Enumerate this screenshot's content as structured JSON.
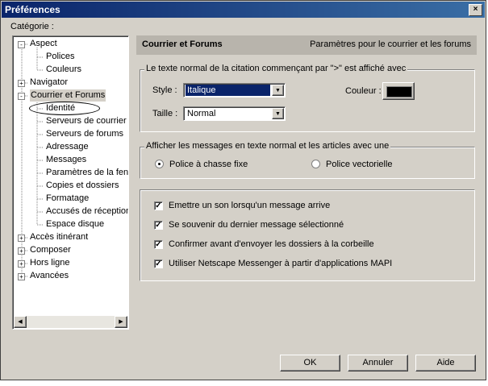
{
  "window": {
    "title": "Préférences",
    "close_glyph": "×"
  },
  "category_label": "Catégorie :",
  "tree": {
    "items": [
      {
        "label": "Aspect",
        "level": 0,
        "expander": "-"
      },
      {
        "label": "Polices",
        "level": 1
      },
      {
        "label": "Couleurs",
        "level": 1
      },
      {
        "label": "Navigator",
        "level": 0,
        "expander": "+"
      },
      {
        "label": "Courrier et Forums",
        "level": 0,
        "expander": "-",
        "selected": true
      },
      {
        "label": "Identité",
        "level": 1,
        "circled": true
      },
      {
        "label": "Serveurs de courrier",
        "level": 1
      },
      {
        "label": "Serveurs de forums",
        "level": 1
      },
      {
        "label": "Adressage",
        "level": 1
      },
      {
        "label": "Messages",
        "level": 1
      },
      {
        "label": "Paramètres de la fenê",
        "level": 1
      },
      {
        "label": "Copies et dossiers",
        "level": 1
      },
      {
        "label": "Formatage",
        "level": 1
      },
      {
        "label": "Accusés de réception",
        "level": 1
      },
      {
        "label": "Espace disque",
        "level": 1
      },
      {
        "label": "Accès itinérant",
        "level": 0,
        "expander": "+"
      },
      {
        "label": "Composer",
        "level": 0,
        "expander": "+"
      },
      {
        "label": "Hors ligne",
        "level": 0,
        "expander": "+"
      },
      {
        "label": "Avancées",
        "level": 0,
        "expander": "+"
      }
    ],
    "scroll_left_glyph": "◀",
    "scroll_right_glyph": "▶"
  },
  "panel": {
    "title": "Courrier et Forums",
    "subtitle": "Paramètres pour le courrier et les forums"
  },
  "quote_group": {
    "legend": "Le texte normal de la citation commençant par \">\" est affiché avec",
    "style_label": "Style :",
    "style_value": "Italique",
    "size_label": "Taille :",
    "size_value": "Normal",
    "color_label": "Couleur :",
    "color_value": "#000000",
    "arrow_glyph": "▼"
  },
  "font_group": {
    "legend": "Afficher les messages en texte normal et les articles avec une",
    "options": [
      {
        "label": "Police à chasse fixe",
        "selected": true
      },
      {
        "label": "Police vectorielle",
        "selected": false
      }
    ]
  },
  "checks": {
    "mark": "✓",
    "items": [
      {
        "label": "Emettre un son lorsqu'un message arrive",
        "checked": true
      },
      {
        "label": "Se souvenir du dernier message sélectionné",
        "checked": true
      },
      {
        "label": "Confirmer avant d'envoyer les dossiers à la corbeille",
        "checked": true
      },
      {
        "label": "Utiliser Netscape Messenger à partir d'applications MAPI",
        "checked": true
      }
    ]
  },
  "buttons": {
    "ok": "OK",
    "cancel": "Annuler",
    "help": "Aide"
  },
  "colors": {
    "titlebar_start": "#0a246a",
    "titlebar_end": "#3a6ea5",
    "selection": "#0a246a",
    "face": "#d4d0c8"
  }
}
